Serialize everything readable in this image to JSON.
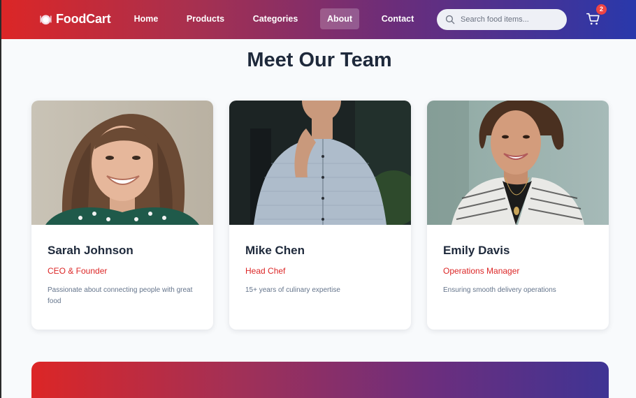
{
  "brand": {
    "name": "FoodCart",
    "icon": "plate-icon"
  },
  "nav": {
    "links": [
      {
        "label": "Home",
        "active": false
      },
      {
        "label": "Products",
        "active": false
      },
      {
        "label": "Categories",
        "active": false
      },
      {
        "label": "About",
        "active": true
      },
      {
        "label": "Contact",
        "active": false
      }
    ]
  },
  "search": {
    "placeholder": "Search food items...",
    "value": ""
  },
  "cart": {
    "count": "2",
    "icon": "cart-icon"
  },
  "page": {
    "title": "Meet Our Team"
  },
  "team": [
    {
      "name": "Sarah Johnson",
      "role": "CEO & Founder",
      "bio": "Passionate about connecting people with great food"
    },
    {
      "name": "Mike Chen",
      "role": "Head Chef",
      "bio": "15+ years of culinary expertise"
    },
    {
      "name": "Emily Davis",
      "role": "Operations Manager",
      "bio": "Ensuring smooth delivery operations"
    }
  ],
  "colors": {
    "accent": "#dc2626",
    "heading": "#1e293b",
    "muted": "#64748b",
    "nav_end": "#2938ab"
  }
}
